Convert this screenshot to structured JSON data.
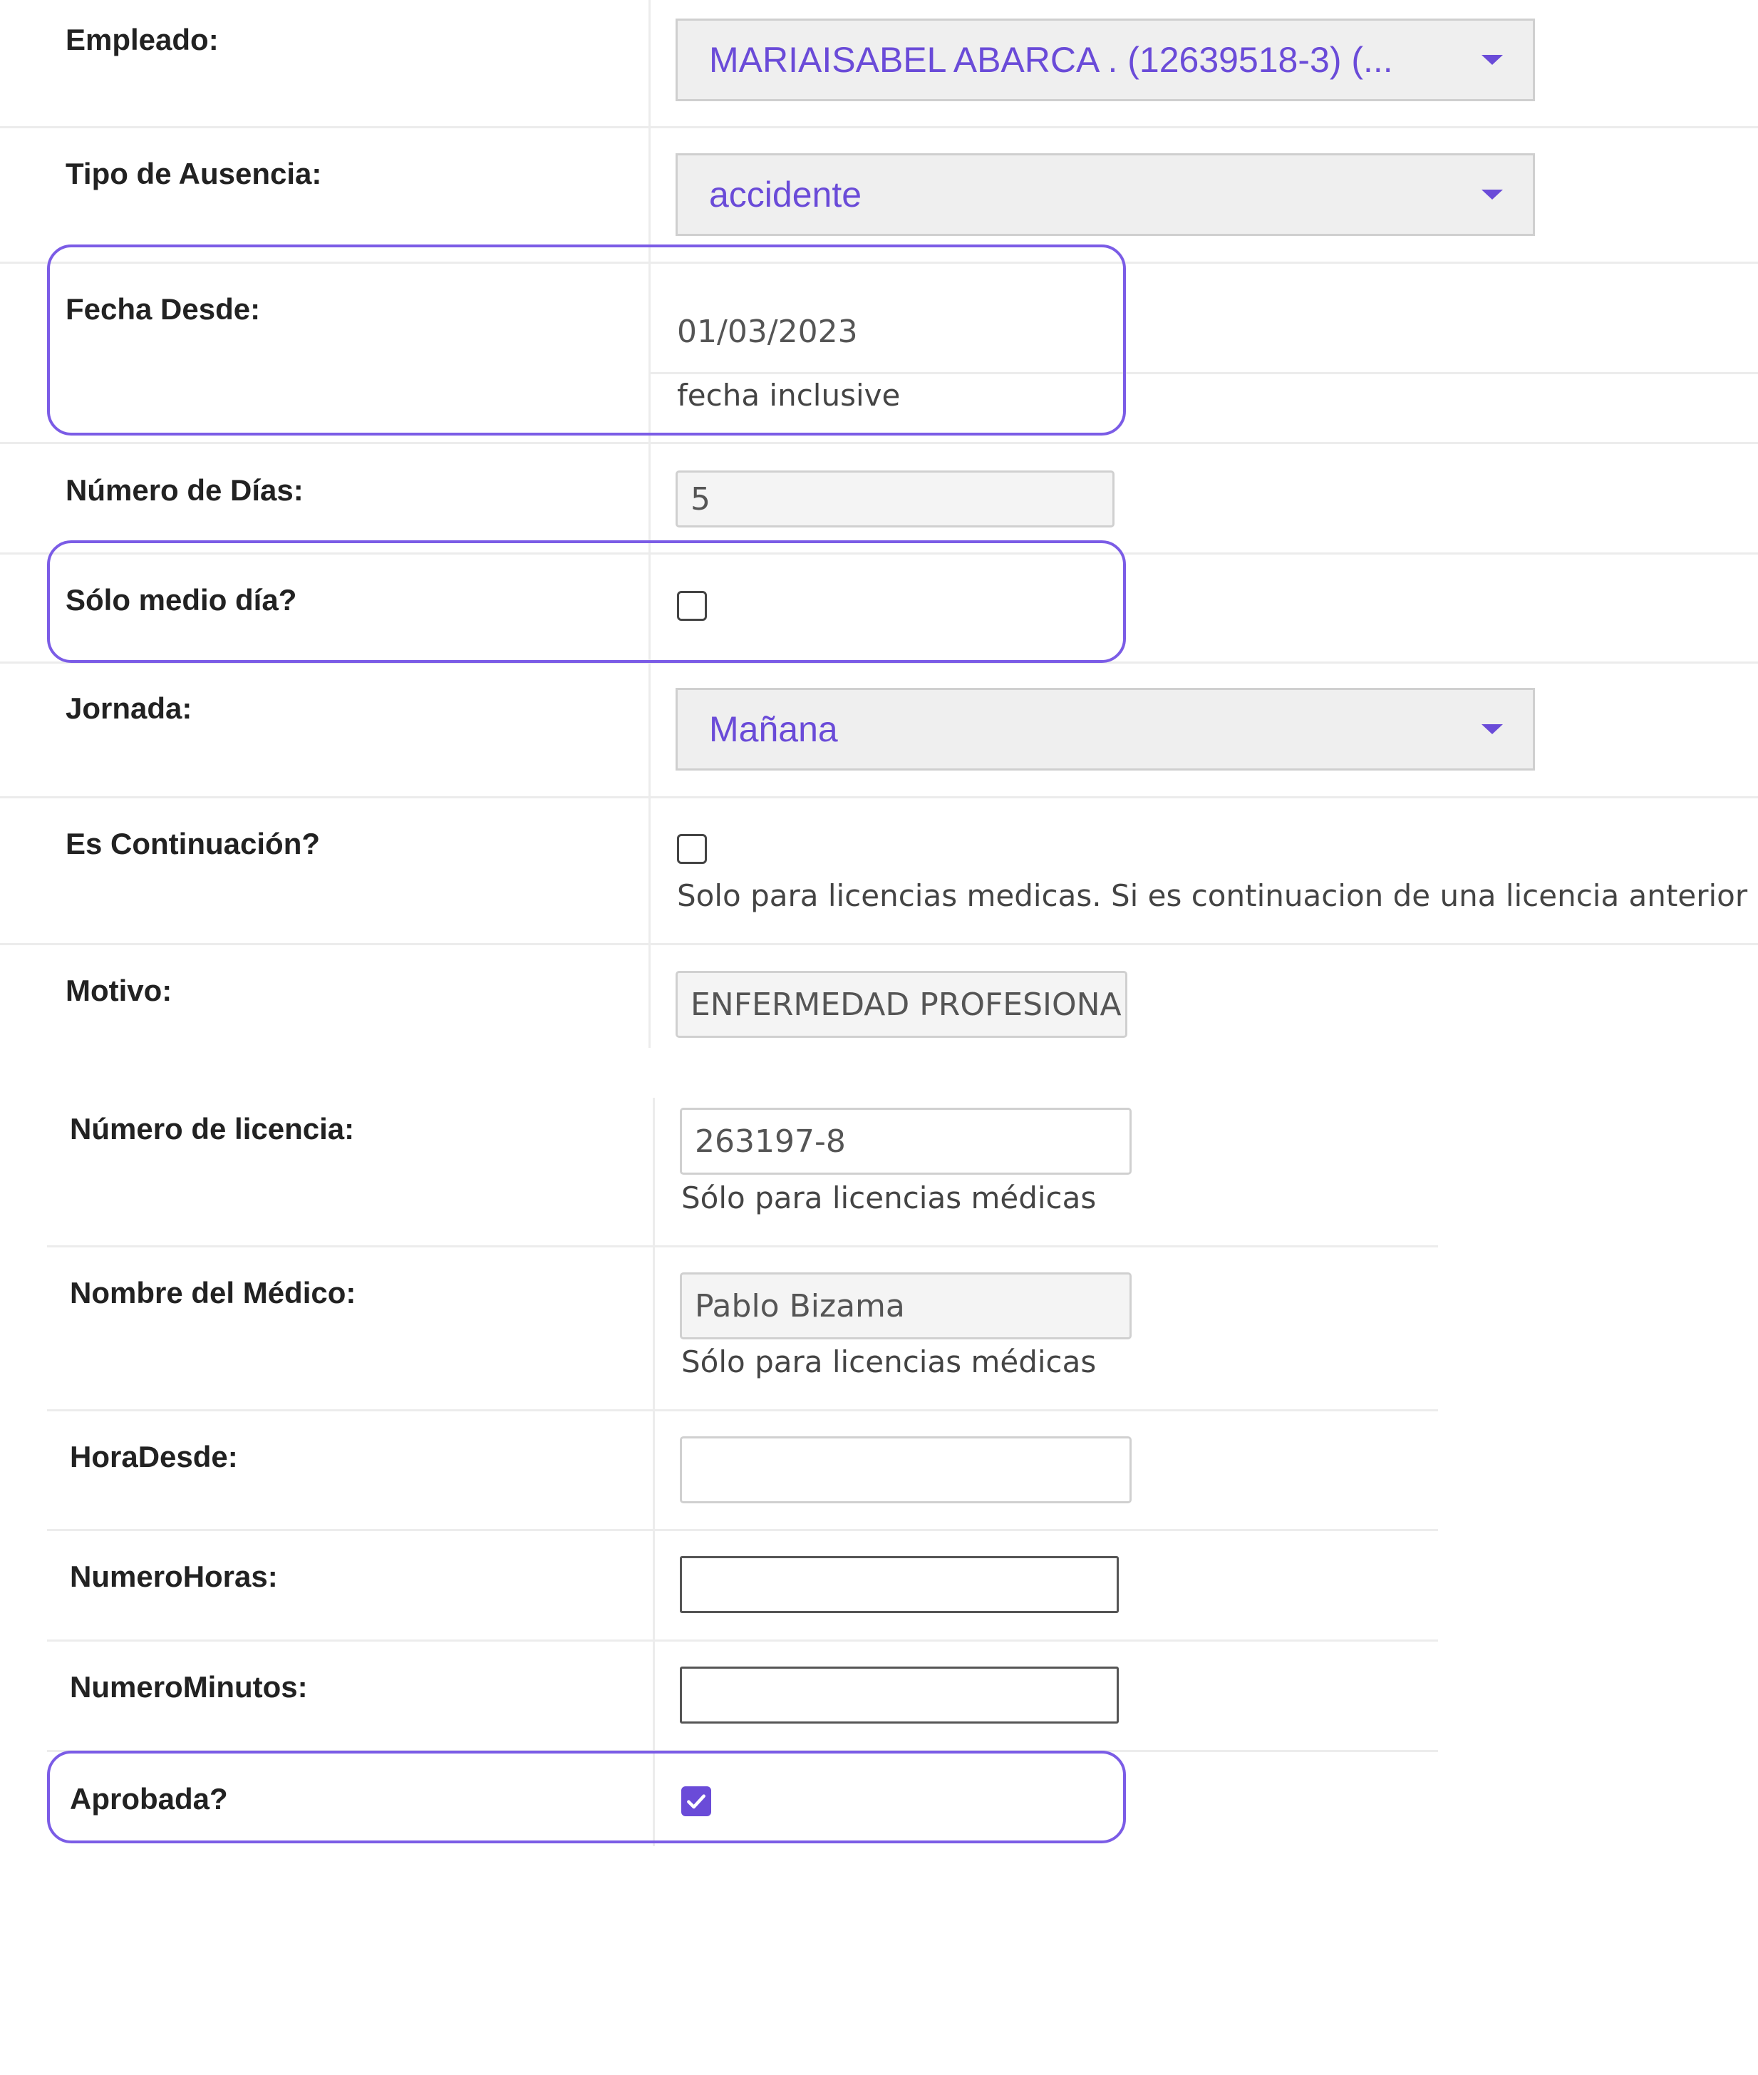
{
  "form": {
    "empleado": {
      "label": "Empleado:",
      "value": "MARIAISABEL ABARCA . (12639518-3) (..."
    },
    "tipo_ausencia": {
      "label": "Tipo de Ausencia:",
      "value": "accidente"
    },
    "fecha_desde": {
      "label": "Fecha Desde:",
      "value": "01/03/2023",
      "hint": "fecha inclusive"
    },
    "numero_dias": {
      "label": "Número de Días:",
      "value": "5"
    },
    "solo_medio_dia": {
      "label": "Sólo medio día?",
      "checked": false
    },
    "jornada": {
      "label": "Jornada:",
      "value": "Mañana"
    },
    "es_continuacion": {
      "label": "Es Continuación?",
      "checked": false,
      "hint": "Solo para licencias medicas. Si es continuacion de una licencia anterior"
    },
    "motivo": {
      "label": "Motivo:",
      "value": "ENFERMEDAD PROFESIONA"
    },
    "numero_licencia": {
      "label": "Número de licencia:",
      "value": "263197-8",
      "hint": "Sólo para licencias médicas"
    },
    "nombre_medico": {
      "label": "Nombre del Médico:",
      "value": "Pablo Bizama",
      "hint": "Sólo para licencias médicas"
    },
    "hora_desde": {
      "label": "HoraDesde:",
      "value": ""
    },
    "numero_horas": {
      "label": "NumeroHoras:",
      "value": ""
    },
    "numero_minutos": {
      "label": "NumeroMinutos:",
      "value": ""
    },
    "aprobada": {
      "label": "Aprobada?",
      "checked": true
    }
  },
  "colors": {
    "accent": "#6a4bd8",
    "highlight": "#7b5ce6"
  }
}
